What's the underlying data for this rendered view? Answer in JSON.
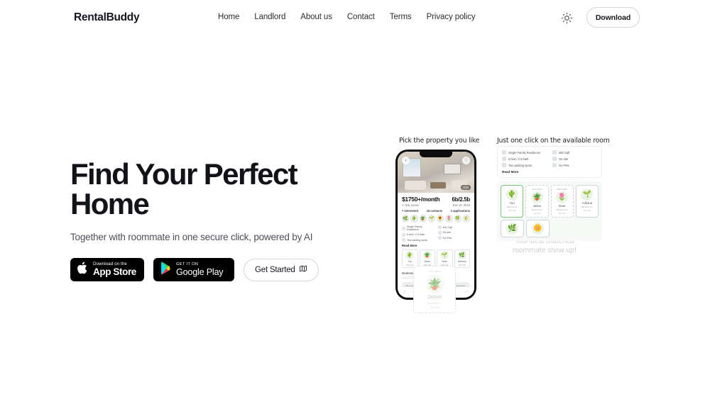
{
  "nav": {
    "logo": "RentalBuddy",
    "links": [
      {
        "label": "Home"
      },
      {
        "label": "Landlord"
      },
      {
        "label": "About us"
      },
      {
        "label": "Contact"
      },
      {
        "label": "Terms"
      },
      {
        "label": "Privacy policy"
      }
    ],
    "theme_toggle_icon": "sun-icon",
    "download_label": "Download"
  },
  "hero": {
    "title_line1": "Find Your Perfect",
    "title_line2": "Home",
    "subtitle": "Together with roommate in one secure click, powered by AI",
    "appstore": {
      "small": "Download on the",
      "big": "App Store",
      "icon": "apple-icon"
    },
    "googleplay": {
      "small": "GET IT ON",
      "big": "Google Play",
      "icon": "play-triangle-icon"
    },
    "get_started": {
      "label": "Get Started",
      "icon": "map-icon"
    }
  },
  "illustration": {
    "caption_left": "Pick the property you like",
    "caption_right": "Just one click on the available room",
    "caption_bottom": "Your best matched roommate show up!",
    "phone": {
      "photo_count": "1/20",
      "back_icon": "chevron-left-icon",
      "save_icon": "heart-circle-icon",
      "price": "$1750+/month",
      "beds": "6b/2.5b",
      "lease": "1 Year Lease",
      "date": "Nov 15, 2023",
      "stats": [
        {
          "label": "7 interested"
        },
        {
          "label": "16 contacts"
        },
        {
          "label": "3 applications"
        }
      ],
      "attrs_left": [
        {
          "label": "Single Family Residence",
          "icon": "house-icon"
        },
        {
          "label": "6 bed / 2.5 bath",
          "icon": "bed-icon"
        },
        {
          "label": "Two parking spots",
          "icon": "car-icon"
        }
      ],
      "attrs_right": [
        {
          "label": "450 Sqft",
          "icon": "ruler-icon"
        },
        {
          "label": "On-site",
          "icon": "person-icon"
        },
        {
          "label": "No Pets",
          "icon": "paw-icon"
        }
      ],
      "read_more": "Read More",
      "rooms": [
        {
          "name": "You",
          "sqft": "450 Sqft"
        },
        {
          "name": "Jason",
          "sqft": "300 Sqft"
        },
        {
          "name": "Sean",
          "sqft": "300 Sqft"
        },
        {
          "name": "Adriana",
          "sqft": "300 Sqft"
        }
      ],
      "location": "Modesto, California, United States",
      "actions": [
        {
          "label": "Group chat"
        },
        {
          "label": "Message"
        },
        {
          "label": "Schedule"
        }
      ],
      "nav_icons": [
        {
          "icon": "home-icon"
        },
        {
          "icon": "heart-icon"
        },
        {
          "icon": "logo-icon"
        },
        {
          "icon": "chat-icon"
        },
        {
          "icon": "profile-icon"
        }
      ]
    },
    "panel": {
      "attrs_left": [
        {
          "label": "Single Family Residence",
          "icon": "house-icon"
        },
        {
          "label": "6 bed / 2.5 bath",
          "icon": "bed-icon"
        },
        {
          "label": "Two parking spots",
          "icon": "car-icon"
        }
      ],
      "attrs_right": [
        {
          "label": "450 Sqft",
          "icon": "ruler-icon"
        },
        {
          "label": "On-site",
          "icon": "person-icon"
        },
        {
          "label": "No Pets",
          "icon": "paw-icon"
        }
      ],
      "read_more": "Read More",
      "rooms": [
        {
          "match": "",
          "name": "You",
          "bedroom": "Bedroom 1",
          "sqft": "450 Sqft",
          "style": "you"
        },
        {
          "match": "71% match",
          "name": "Jason",
          "bedroom": "Bedroom 2",
          "sqft": "300 Sqft",
          "style": "dashed"
        },
        {
          "match": "68% match",
          "name": "Sean",
          "bedroom": "Bedroom 3",
          "sqft": "300 Sqft",
          "style": "dashed"
        },
        {
          "match": "",
          "name": "Adriana",
          "bedroom": "Bedroom 4",
          "sqft": "300 Sqft",
          "style": "solid"
        }
      ],
      "rooms_row2": [
        {
          "name": "",
          "style": "solid"
        },
        {
          "name": "",
          "style": "solid"
        }
      ]
    },
    "match_card": {
      "match": "71% match",
      "name": "Jason",
      "bedroom": "Bedroom 2",
      "sqft": "300 Sqft"
    }
  }
}
